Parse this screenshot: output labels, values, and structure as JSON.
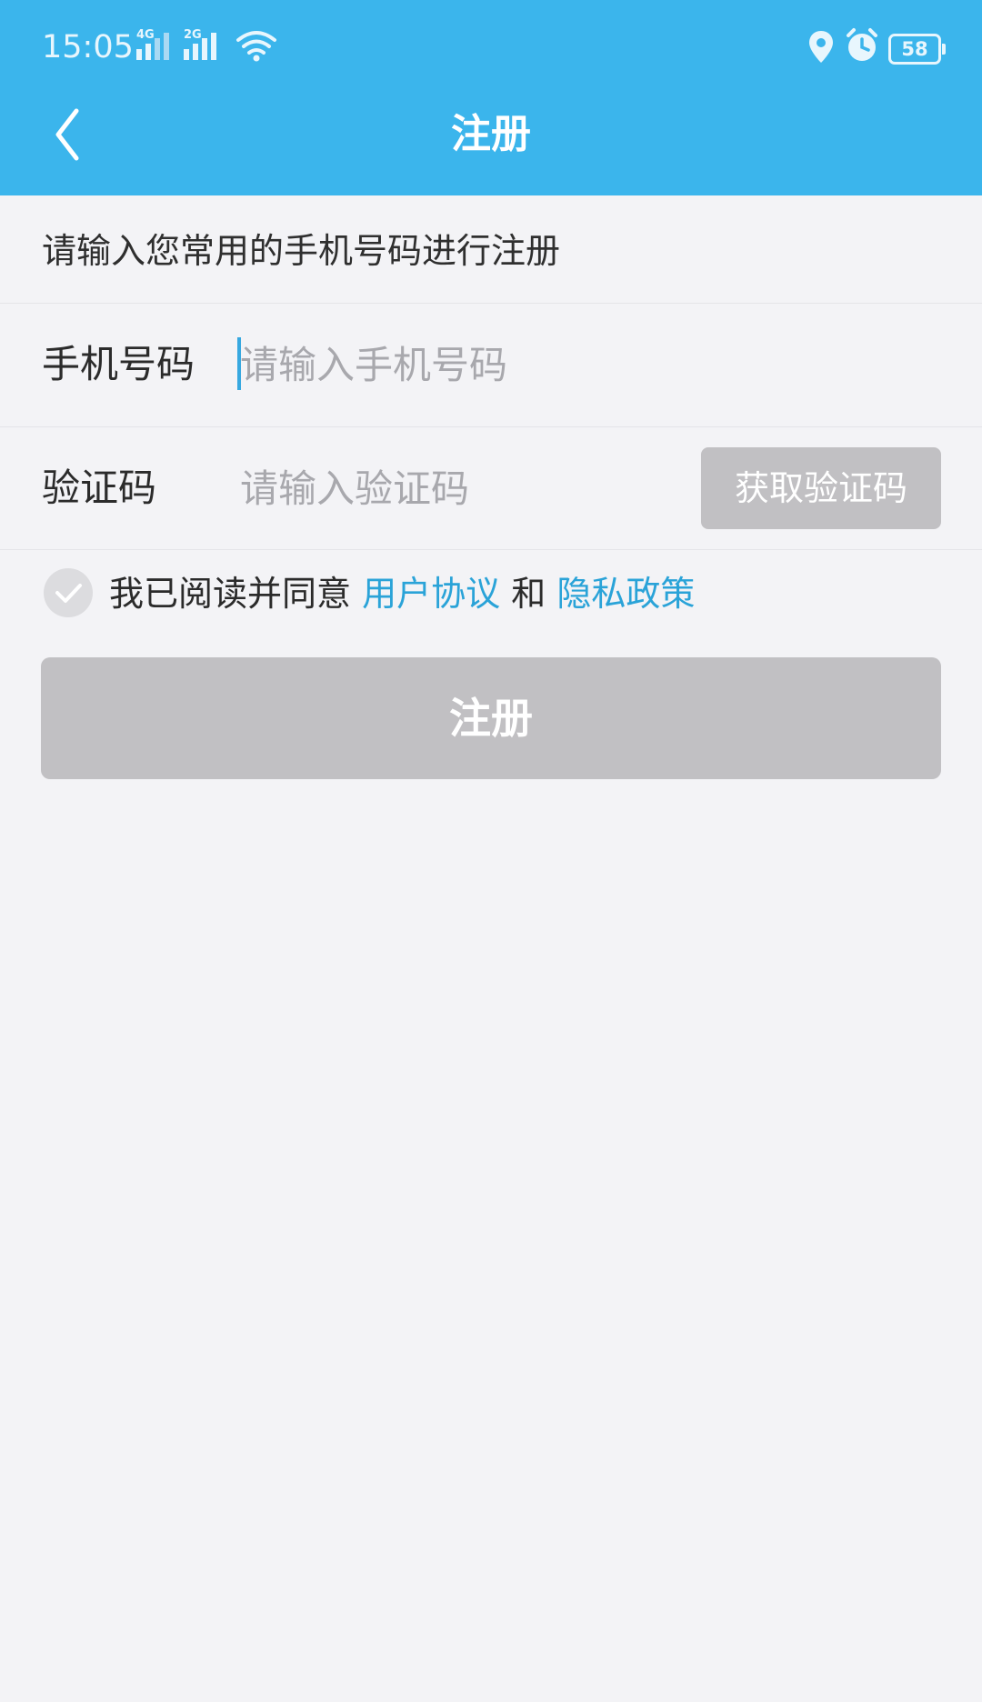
{
  "status_bar": {
    "time": "15:05",
    "signal_1_label": "4G",
    "signal_2_label": "2G",
    "battery": "58",
    "icons": [
      "signal-4g-icon",
      "signal-2g-icon",
      "wifi-icon",
      "location-icon",
      "alarm-icon",
      "battery-icon"
    ]
  },
  "header": {
    "title": "注册",
    "back_icon": "chevron-left-icon"
  },
  "intro": "请输入您常用的手机号码进行注册",
  "phone": {
    "label": "手机号码",
    "placeholder": "请输入手机号码",
    "value": ""
  },
  "code": {
    "label": "验证码",
    "placeholder": "请输入验证码",
    "value": "",
    "button_label": "获取验证码"
  },
  "agreement": {
    "prefix": "我已阅读并同意",
    "user_agreement": "用户协议",
    "and": "和",
    "privacy_policy": "隐私政策",
    "checked": false
  },
  "register_button": "注册",
  "colors": {
    "header": "#3bb5ec",
    "background": "#f3f3f6",
    "link": "#2aa3d8",
    "disabled_button": "#c1c0c3"
  }
}
